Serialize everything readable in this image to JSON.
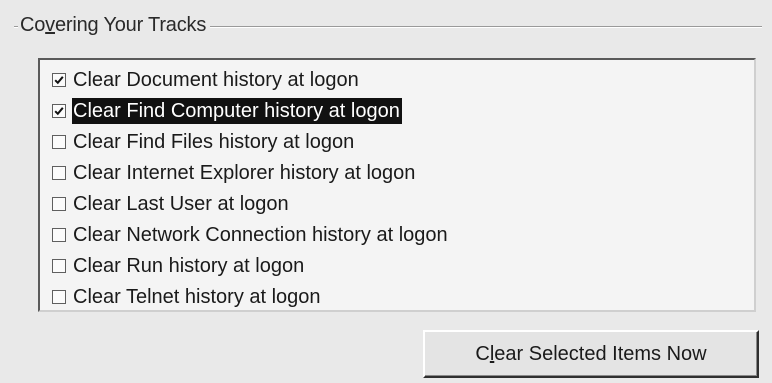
{
  "group": {
    "title_prefix": "Co",
    "title_accel": "v",
    "title_suffix": "ering Your Tracks"
  },
  "list": {
    "items": [
      {
        "label": "Clear Document history at logon",
        "checked": true,
        "selected": false
      },
      {
        "label": "Clear Find Computer history at logon",
        "checked": true,
        "selected": true
      },
      {
        "label": "Clear Find Files history at logon",
        "checked": false,
        "selected": false
      },
      {
        "label": "Clear Internet Explorer history at logon",
        "checked": false,
        "selected": false
      },
      {
        "label": "Clear Last User at logon",
        "checked": false,
        "selected": false
      },
      {
        "label": "Clear Network Connection history at logon",
        "checked": false,
        "selected": false
      },
      {
        "label": "Clear Run history at logon",
        "checked": false,
        "selected": false
      },
      {
        "label": "Clear Telnet history at logon",
        "checked": false,
        "selected": false
      }
    ]
  },
  "button": {
    "label_prefix": "C",
    "label_accel": "l",
    "label_suffix": "ear Selected Items Now"
  }
}
